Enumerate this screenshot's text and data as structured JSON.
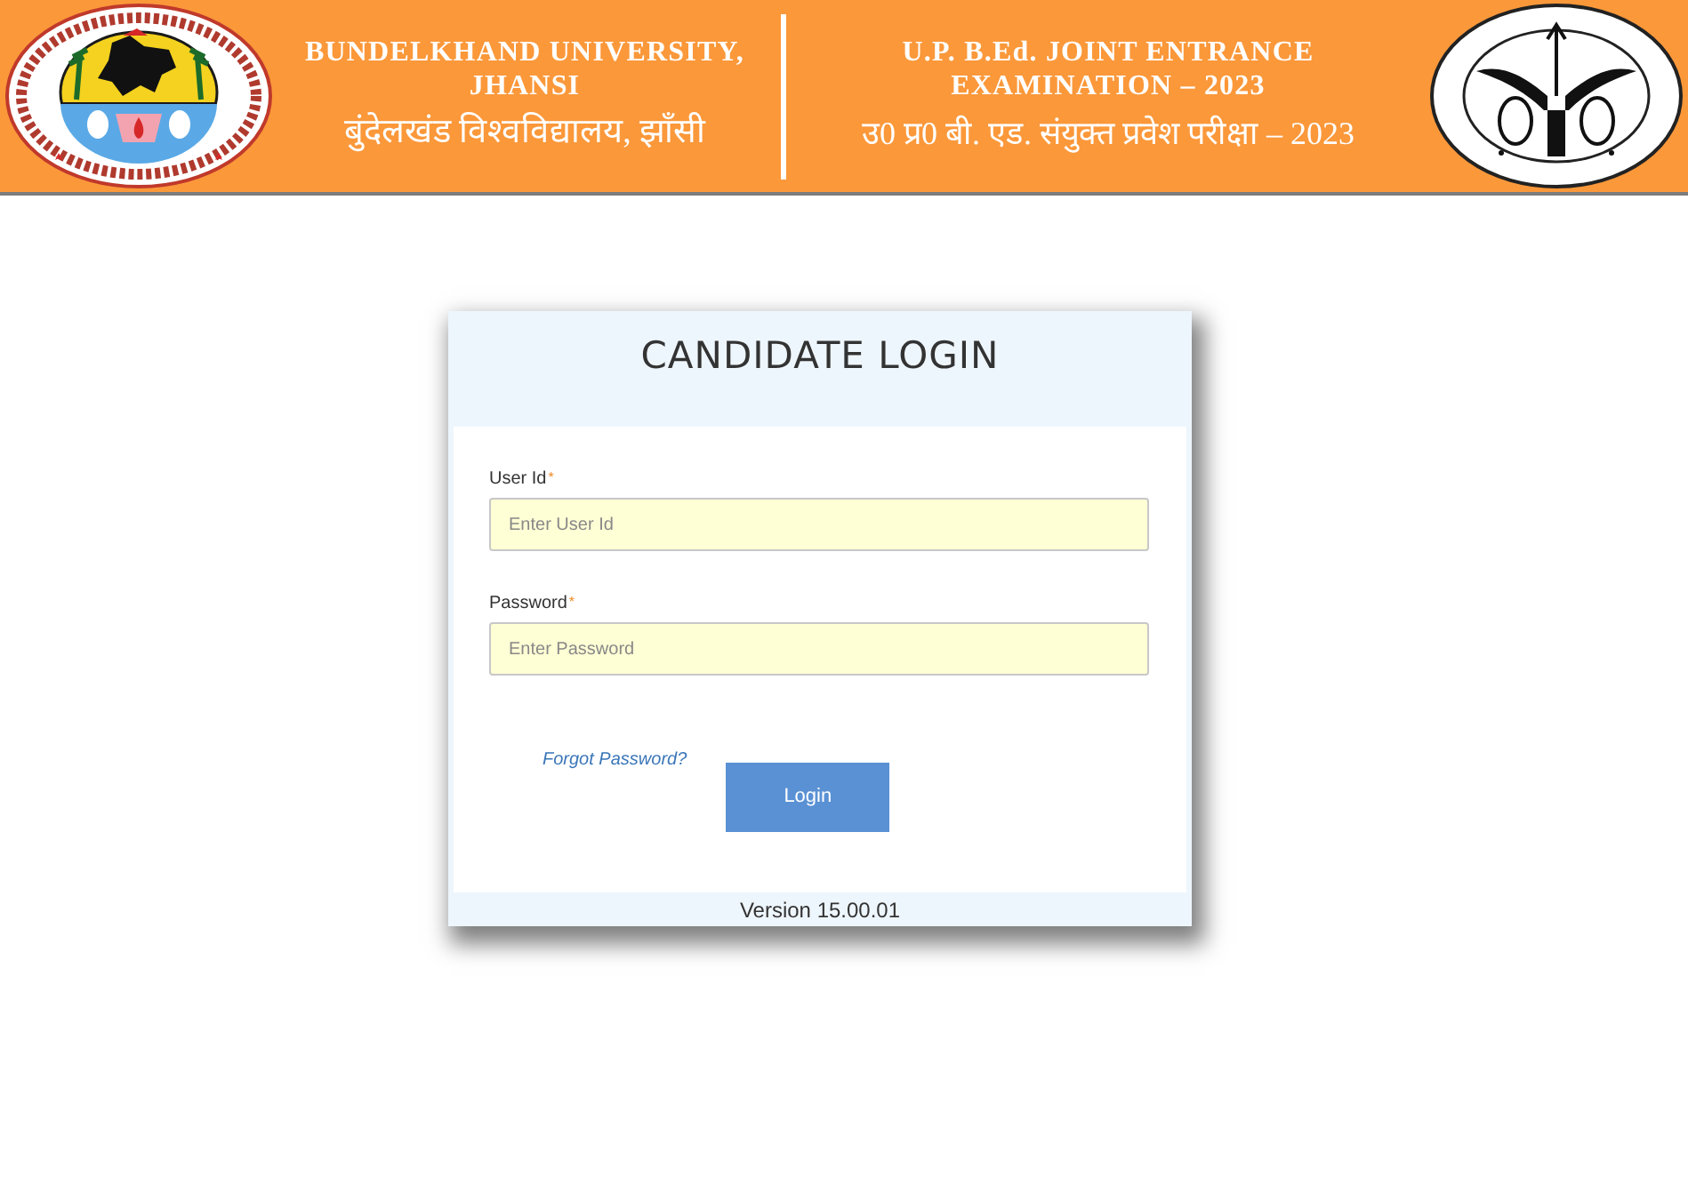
{
  "header": {
    "university": {
      "name_lines": [
        "BUNDELKHAND UNIVERSITY,",
        "JHANSI"
      ],
      "name_hindi": "बुंदेलखंड विश्वविद्यालय, झाँसी"
    },
    "exam": {
      "title_lines": [
        "U.P. B.Ed. JOINT ENTRANCE",
        "EXAMINATION – 2023"
      ],
      "title_hindi": "उ0 प्र0 बी. एड. संयुक्त प्रवेश परीक्षा – 2023"
    }
  },
  "login": {
    "title": "CANDIDATE LOGIN",
    "fields": [
      {
        "label": "User Id",
        "required_mark": "*",
        "placeholder": "Enter User Id"
      },
      {
        "label": "Password",
        "required_mark": "*",
        "placeholder": "Enter Password"
      }
    ],
    "forgot_link": "Forgot Password?",
    "submit_button": "Login",
    "version": "Version 15.00.01"
  }
}
